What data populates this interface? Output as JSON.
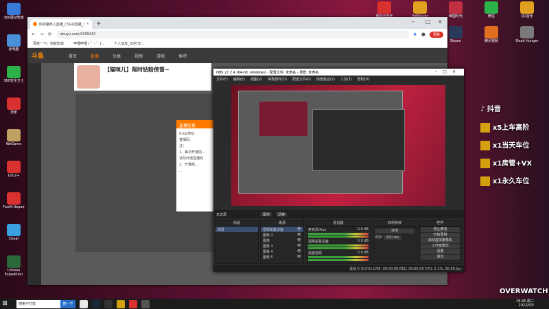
{
  "desktop_left": [
    {
      "label": "360驱动管家",
      "color": "#3a7ad9"
    },
    {
      "label": "此电脑",
      "color": "#4a90d9"
    },
    {
      "label": "360安全卫士",
      "color": "#2db24a"
    },
    {
      "label": "汤米",
      "color": "#d93030"
    },
    {
      "label": "WeGame",
      "color": "#c0a060"
    },
    {
      "label": "LOL2+",
      "color": "#d93030"
    },
    {
      "label": "FiveM Repair",
      "color": "#d93030"
    },
    {
      "label": "Cheat",
      "color": "#3aa0e0"
    },
    {
      "label": "Lhicess Expedition",
      "color": "#2a6a3a"
    }
  ],
  "desktop_right": [
    {
      "label": "网易云音乐",
      "color": "#d93030"
    },
    {
      "label": "PotPlayer",
      "color": "#e0a020"
    },
    {
      "label": "帝国时代",
      "color": "#c03040"
    },
    {
      "label": "微信",
      "color": "#2db24a"
    },
    {
      "label": "QQ音乐",
      "color": "#e0a020"
    },
    {
      "label": "TeamViewer",
      "color": "#2a6fc9"
    },
    {
      "label": "腾讯QQ",
      "color": "#3aa0e0"
    },
    {
      "label": "Steam",
      "color": "#2a3a5a"
    },
    {
      "label": "腾讯视频",
      "color": "#e07020"
    },
    {
      "label": "Dead Hunger",
      "color": "#7a7a7a"
    }
  ],
  "chrome": {
    "tab_title": "你的猫咪儿直播_CSGO直播_斗鱼",
    "url": "douyu.com/9399415",
    "update_label": "更新",
    "new_tab": "+",
    "close": "×",
    "bookmarks": [
      "百度一下，你就知道",
      "哔哩哔哩 ( ゜- ゜)...",
      "个人信息_3D打印..."
    ]
  },
  "site": {
    "logo": "斗鱼",
    "nav": [
      "首页",
      "直播",
      "分类",
      "视频",
      "游戏",
      "鱼吧"
    ],
    "room_title": "【猫咪儿】限时钻粉傍督~",
    "dialog_title": "直播信息",
    "dialog_lines": [
      "rtmp地址：",
      "直播码：",
      "注：",
      "1、每次开播前...",
      "请勿外泄直播码",
      "2、开播后...",
      "..."
    ],
    "hint": "你还可以「主播申请」..."
  },
  "obs": {
    "title": "OBS 27.2.4 (64-bit, windows) - 配置文件: 未命名 - 场景: 未命名",
    "menu": [
      "文件(F)",
      "编辑(E)",
      "视图(V)",
      "停靠部件(D)",
      "配置文件(P)",
      "场景集合(S)",
      "工具(T)",
      "帮助(H)"
    ],
    "source_bar": {
      "label": "未选源",
      "properties": "属性",
      "filters": "滤镜"
    },
    "scenes": {
      "header": "场景",
      "items": [
        "场景"
      ]
    },
    "sources": {
      "header": "来源",
      "items": [
        "视频采集设备",
        "图像 2",
        "图像",
        "图像 3",
        "图像 4",
        "图像 5"
      ]
    },
    "mixer": {
      "header": "混音器",
      "tracks": [
        {
          "name": "麦克风/Aux",
          "db": "0.0 dB"
        },
        {
          "name": "视频采集设备",
          "db": "0.0 dB"
        },
        {
          "name": "桌面音频",
          "db": "0.0 dB"
        }
      ]
    },
    "transitions": {
      "header": "转场特效",
      "type": "淡出",
      "duration_label": "时长",
      "duration": "300 ms"
    },
    "controls": {
      "header": "控件",
      "buttons": [
        "停止推流",
        "开始录制",
        "启动虚拟摄像机",
        "工作室模式",
        "设置",
        "退出"
      ]
    },
    "status": "丢帧 0 (0.0%)  LIVE: 00:00:00  REC: 00:00:00  CPU: 2.1%, 30.00 fps"
  },
  "overlay": {
    "app": "抖音",
    "lines": [
      "x5上车高阶",
      "x1当天车位",
      "x1房管+VX",
      "x1永久车位"
    ]
  },
  "filename": "OVERWATCH",
  "taskbar": {
    "search_placeholder": "搜索不打扰",
    "search_button": "搜一下",
    "time": "19:45 周二",
    "date": "2022/5/3"
  }
}
